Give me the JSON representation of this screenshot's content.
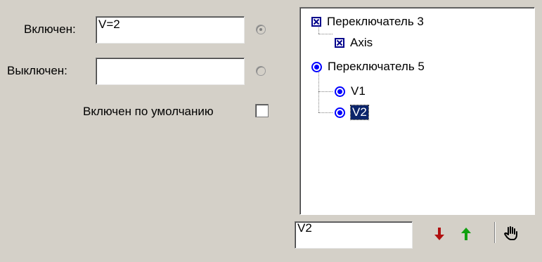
{
  "form": {
    "on_label": "Включен:",
    "on_value": "V=2",
    "off_label": "Выключен:",
    "off_value": "",
    "default_on_label": "Включен по умолчанию",
    "default_on_checked": false
  },
  "tree": {
    "nodes": [
      {
        "label": "Переключатель 3",
        "type": "checkbox",
        "checked": true
      },
      {
        "label": "Axis",
        "type": "checkbox",
        "checked": true
      },
      {
        "label": "Переключатель 5",
        "type": "radio",
        "checked": true
      },
      {
        "label": "V1",
        "type": "radio",
        "checked": true
      },
      {
        "label": "V2",
        "type": "radio",
        "checked": true,
        "selected": true
      }
    ]
  },
  "footer": {
    "selected_value": "V2"
  },
  "icons": {
    "move_down": "arrow-down-icon",
    "move_up": "arrow-up-icon",
    "hand": "hand-cursor-icon"
  },
  "colors": {
    "down_arrow": "#b01010",
    "up_arrow": "#10a010",
    "selection": "#0a246a",
    "tree_icon": "#0000ff"
  }
}
